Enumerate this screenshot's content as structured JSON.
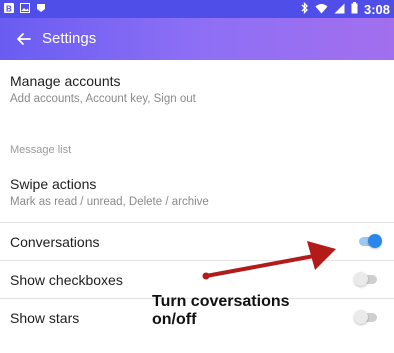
{
  "status_bar": {
    "time": "3:08",
    "left_icons": [
      "notification-b-icon",
      "image-icon",
      "app-icon"
    ],
    "right_icons": [
      "bluetooth-icon",
      "wifi-icon",
      "signal-icon",
      "battery-icon"
    ]
  },
  "app_bar": {
    "title": "Settings",
    "back_icon": "back-arrow-icon"
  },
  "manage_accounts": {
    "title": "Manage accounts",
    "subtitle": "Add accounts, Account key, Sign out"
  },
  "section_message_list": "Message list",
  "swipe_actions": {
    "title": "Swipe actions",
    "subtitle": "Mark as read / unread, Delete / archive"
  },
  "toggles": [
    {
      "label": "Conversations",
      "on": true
    },
    {
      "label": "Show checkboxes",
      "on": false
    },
    {
      "label": "Show stars",
      "on": false
    }
  ],
  "annotation": {
    "line1": "Turn coversations",
    "line2": "on/off",
    "arrow_color": "#b31b1b"
  },
  "colors": {
    "accent": "#2a86ea",
    "app_bar_start": "#6a5cf2",
    "app_bar_end": "#a26fee"
  }
}
